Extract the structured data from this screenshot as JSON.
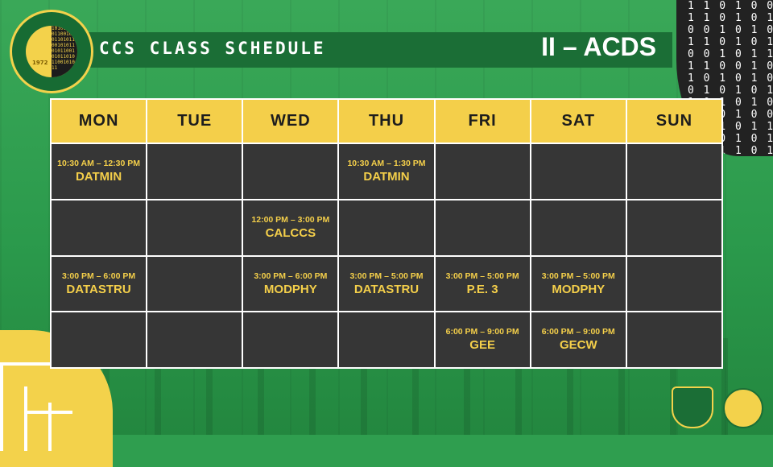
{
  "header": {
    "title": "CCS CLASS SCHEDULE",
    "section": "II – ACDS"
  },
  "logo": {
    "year": "1972"
  },
  "days": [
    "MON",
    "TUE",
    "WED",
    "THU",
    "FRI",
    "SAT",
    "SUN"
  ],
  "rows": [
    [
      {
        "time": "10:30 AM – 12:30 PM",
        "subject": "DATMIN"
      },
      {
        "time": "",
        "subject": ""
      },
      {
        "time": "",
        "subject": ""
      },
      {
        "time": "10:30 AM – 1:30 PM",
        "subject": "DATMIN"
      },
      {
        "time": "",
        "subject": ""
      },
      {
        "time": "",
        "subject": ""
      },
      {
        "time": "",
        "subject": ""
      }
    ],
    [
      {
        "time": "",
        "subject": ""
      },
      {
        "time": "",
        "subject": ""
      },
      {
        "time": "12:00 PM – 3:00 PM",
        "subject": "CALCCS"
      },
      {
        "time": "",
        "subject": ""
      },
      {
        "time": "",
        "subject": ""
      },
      {
        "time": "",
        "subject": ""
      },
      {
        "time": "",
        "subject": ""
      }
    ],
    [
      {
        "time": "3:00 PM – 6:00 PM",
        "subject": "DATASTRU"
      },
      {
        "time": "",
        "subject": ""
      },
      {
        "time": "3:00 PM – 6:00 PM",
        "subject": "MODPHY"
      },
      {
        "time": "3:00 PM – 5:00 PM",
        "subject": "DATASTRU"
      },
      {
        "time": "3:00 PM – 5:00 PM",
        "subject": "P.E. 3"
      },
      {
        "time": "3:00 PM – 5:00 PM",
        "subject": "MODPHY"
      },
      {
        "time": "",
        "subject": ""
      }
    ],
    [
      {
        "time": "",
        "subject": ""
      },
      {
        "time": "",
        "subject": ""
      },
      {
        "time": "",
        "subject": ""
      },
      {
        "time": "",
        "subject": ""
      },
      {
        "time": "6:00 PM – 9:00 PM",
        "subject": "GEE"
      },
      {
        "time": "6:00 PM – 9:00 PM",
        "subject": "GECW"
      },
      {
        "time": "",
        "subject": ""
      }
    ]
  ],
  "colors": {
    "accent": "#f4cf4a",
    "cell_bg": "#363636",
    "brand_green": "#1b6e36"
  }
}
